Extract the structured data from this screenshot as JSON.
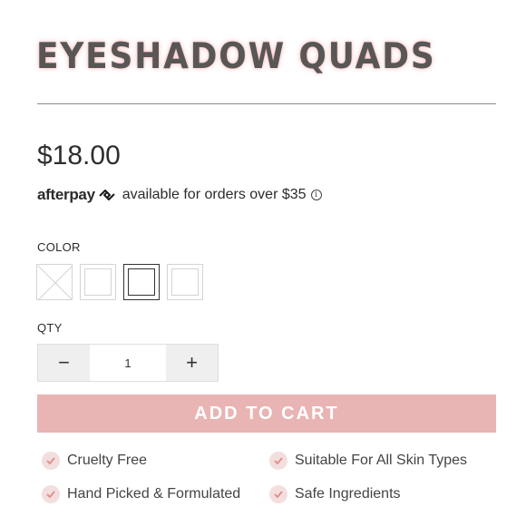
{
  "product": {
    "title": "EYESHADOW QUADS",
    "price": "$18.00"
  },
  "afterpay": {
    "logo_text": "afterpay",
    "message": "available for orders over $35",
    "info_icon": "info-icon"
  },
  "color": {
    "label": "COLOR",
    "swatches": [
      {
        "state": "unavailable"
      },
      {
        "state": "available"
      },
      {
        "state": "selected"
      },
      {
        "state": "available"
      }
    ]
  },
  "qty": {
    "label": "QTY",
    "value": "1",
    "minus": "−",
    "plus": "+"
  },
  "cart": {
    "button_label": "ADD TO CART",
    "button_color": "#e8b4b4"
  },
  "features": [
    {
      "label": "Cruelty Free"
    },
    {
      "label": "Suitable For All Skin Types"
    },
    {
      "label": "Hand Picked & Formulated"
    },
    {
      "label": "Safe Ingredients"
    }
  ],
  "colors": {
    "accent": "#e8b4b4",
    "check_bg": "#f3dede",
    "check_mark": "#e48a8a",
    "title": "#595656"
  }
}
